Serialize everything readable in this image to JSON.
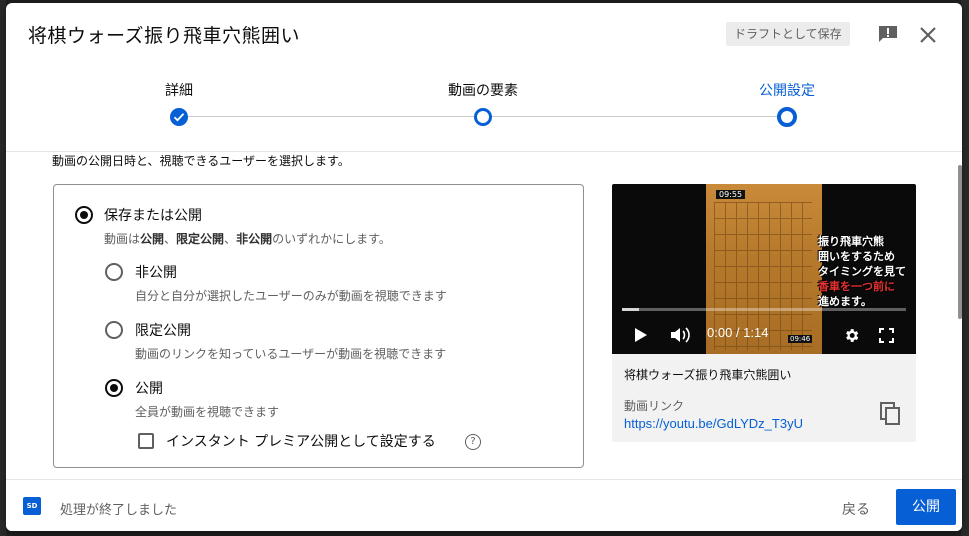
{
  "dialog": {
    "title": "将棋ウォーズ振り飛車穴熊囲い",
    "draft_label": "ドラフトとして保存"
  },
  "stepper": {
    "steps": [
      {
        "label": "詳細",
        "state": "done"
      },
      {
        "label": "動画の要素",
        "state": "open"
      },
      {
        "label": "公開設定",
        "state": "current"
      }
    ]
  },
  "visibility": {
    "intro": "動画の公開日時と、視聴できるユーザーを選択します。",
    "save_or_publish": {
      "label": "保存または公開",
      "desc_pre": "動画は",
      "desc_b1": "公開",
      "desc_sep1": "、",
      "desc_b2": "限定公開",
      "desc_sep2": "、",
      "desc_b3": "非公開",
      "desc_post": "のいずれかにします。",
      "checked": true
    },
    "options": [
      {
        "label": "非公開",
        "desc": "自分と自分が選択したユーザーのみが動画を視聴できます",
        "checked": false
      },
      {
        "label": "限定公開",
        "desc": "動画のリンクを知っているユーザーが動画を視聴できます",
        "checked": false
      },
      {
        "label": "公開",
        "desc": "全員が動画を視聴できます",
        "checked": true
      }
    ],
    "premiere_label": "インスタント プレミア公開として設定する",
    "premiere_checked": false
  },
  "preview": {
    "thumb_time": "09:55",
    "thumb_text_lines": [
      "振り飛車穴熊",
      "囲いをするため",
      "タイミングを見て",
      "香車を一つ前に",
      "進めます。"
    ],
    "time_display": "0:00 / 1:14",
    "corner_time": "09:46",
    "video_title": "将棋ウォーズ振り飛車穴熊囲い",
    "link_label": "動画リンク",
    "link_url": "https://youtu.be/GdLYDz_T3yU"
  },
  "footer": {
    "badge": "SD",
    "status": "処理が終了しました",
    "back_label": "戻る",
    "publish_label": "公開"
  },
  "colors": {
    "accent": "#065fd4",
    "text_primary": "#0d0d0d",
    "text_secondary": "#606060"
  }
}
